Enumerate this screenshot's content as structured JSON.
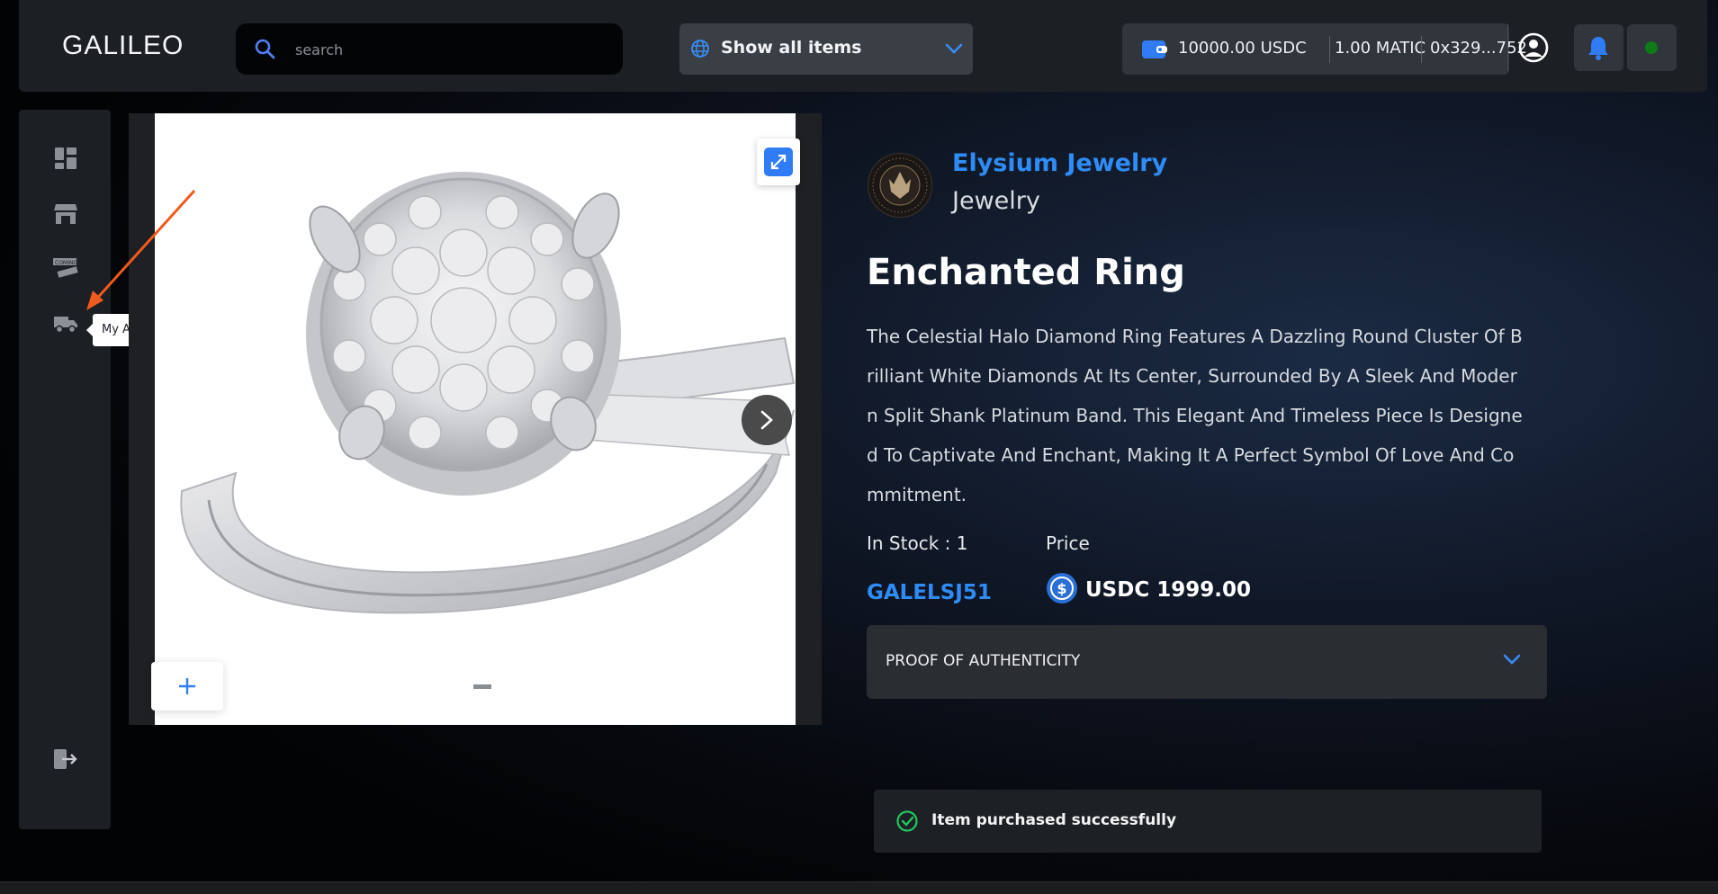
{
  "header": {
    "logo": "GALILEO",
    "search_placeholder": "search",
    "filter_label": "Show all items",
    "wallet": {
      "usdc": "10000.00 USDC",
      "matic": "1.00 MATIC",
      "address": "0x329...752"
    },
    "icons": {
      "profile": "user-circle-icon",
      "notifications": "bell-icon",
      "status": "green-dot-icon"
    }
  },
  "sidebar": {
    "items": [
      {
        "name": "dashboard",
        "icon": "grid-icon"
      },
      {
        "name": "marketplace",
        "icon": "storefront-icon"
      },
      {
        "name": "coming-soon",
        "icon": "coming-soon-icon"
      },
      {
        "name": "my-activity",
        "icon": "truck-icon"
      }
    ],
    "tooltip": "My Activity",
    "logout_icon": "logout-icon"
  },
  "product": {
    "brand_name": "Elysium Jewelry",
    "brand_category": "Jewelry",
    "title": "Enchanted Ring",
    "description": "The Celestial Halo Diamond Ring Features A Dazzling Round Cluster Of Brilliant White Diamonds At Its Center, Surrounded By A Sleek And Modern Split Shank Platinum Band. This Elegant And Timeless Piece Is Designed To Captivate And Enchant, Making It A Perfect Symbol Of Love And Commitment.",
    "stock_label": "In Stock : 1",
    "price_label": "Price",
    "sku": "GALELSJ51",
    "price": "USDC 1999.00",
    "authenticity_label": "PROOF OF AUTHENTICITY"
  },
  "gallery": {
    "zoom_in_label": "+"
  },
  "toast": {
    "message": "Item purchased successfully"
  },
  "colors": {
    "accent": "#2f8cf6",
    "success": "#22c55e",
    "annotation_arrow": "#f05a1e"
  }
}
